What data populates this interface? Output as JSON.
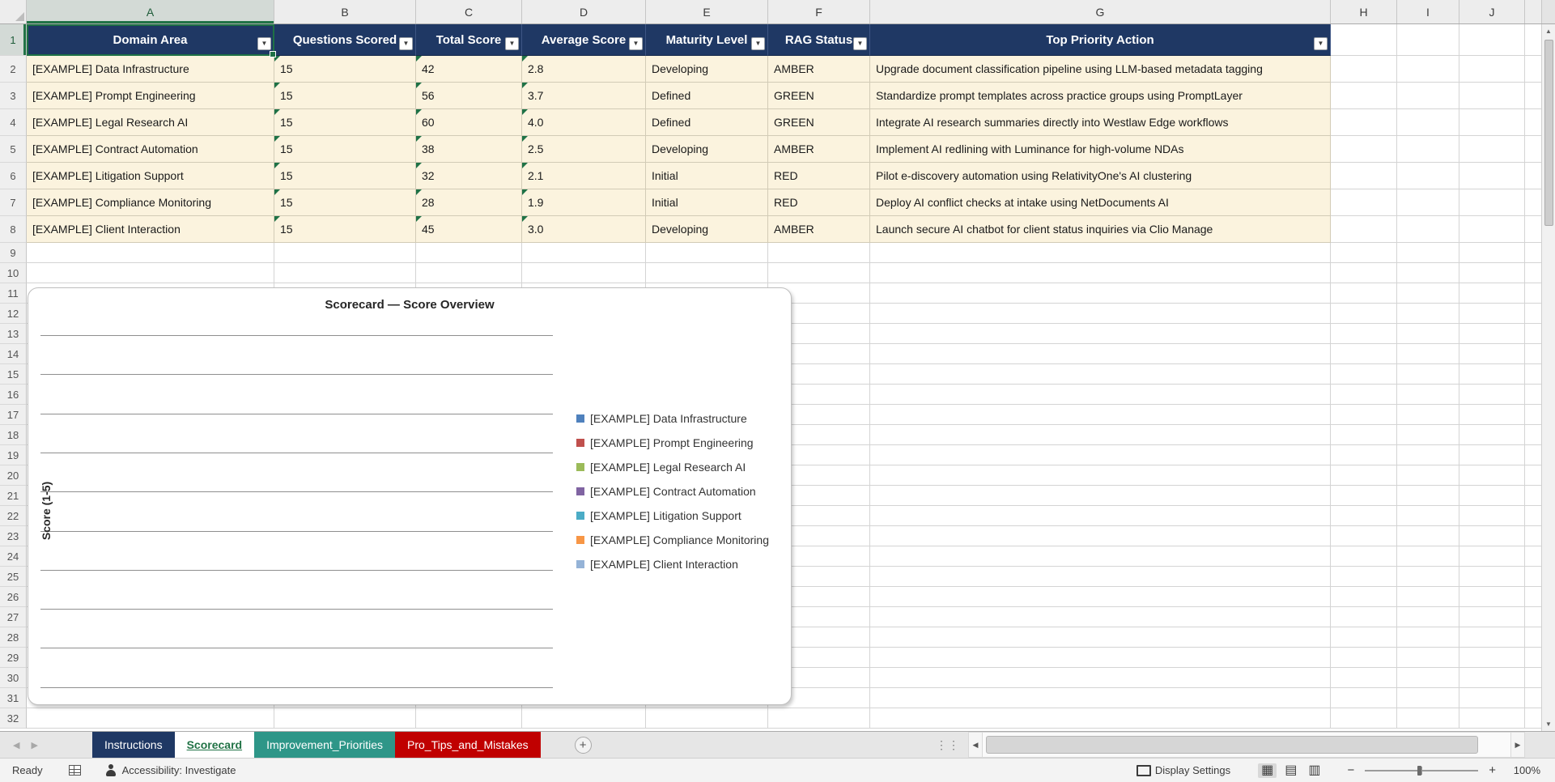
{
  "colors": {
    "accent_green": "#217346",
    "header_navy": "#1F3864",
    "row_fill": "#FBF3DE",
    "tab_instructions": "#1F3864",
    "tab_improvement": "#2E9688",
    "tab_pro_tips": "#C00000"
  },
  "sheet": {
    "columns": [
      {
        "letter": "A"
      },
      {
        "letter": "B"
      },
      {
        "letter": "C"
      },
      {
        "letter": "D"
      },
      {
        "letter": "E"
      },
      {
        "letter": "F"
      },
      {
        "letter": "G"
      },
      {
        "letter": "H"
      },
      {
        "letter": "I"
      },
      {
        "letter": "J"
      }
    ],
    "empty_row_numbers": [
      9,
      10,
      11,
      12,
      13,
      14,
      15,
      16,
      17,
      18,
      19,
      20,
      21,
      22,
      23,
      24,
      25,
      26,
      27,
      28,
      29,
      30,
      31,
      32
    ]
  },
  "table": {
    "header_row_number": "1",
    "headers": [
      {
        "label": "Domain Area"
      },
      {
        "label": "Questions Scored"
      },
      {
        "label": "Total Score"
      },
      {
        "label": "Average Score"
      },
      {
        "label": "Maturity Level"
      },
      {
        "label": "RAG Status"
      },
      {
        "label": "Top Priority Action"
      }
    ],
    "rows": [
      {
        "num": "2",
        "domain": "[EXAMPLE] Data Infrastructure",
        "questions": "15",
        "total": "42",
        "average": "2.8",
        "maturity": "Developing",
        "rag": "AMBER",
        "action": "Upgrade document classification pipeline using LLM-based metadata tagging"
      },
      {
        "num": "3",
        "domain": "[EXAMPLE] Prompt Engineering",
        "questions": "15",
        "total": "56",
        "average": "3.7",
        "maturity": "Defined",
        "rag": "GREEN",
        "action": "Standardize prompt templates across practice groups using PromptLayer"
      },
      {
        "num": "4",
        "domain": "[EXAMPLE] Legal Research AI",
        "questions": "15",
        "total": "60",
        "average": "4.0",
        "maturity": "Defined",
        "rag": "GREEN",
        "action": "Integrate AI research summaries directly into Westlaw Edge workflows"
      },
      {
        "num": "5",
        "domain": "[EXAMPLE] Contract Automation",
        "questions": "15",
        "total": "38",
        "average": "2.5",
        "maturity": "Developing",
        "rag": "AMBER",
        "action": "Implement AI redlining with Luminance for high-volume NDAs"
      },
      {
        "num": "6",
        "domain": "[EXAMPLE] Litigation Support",
        "questions": "15",
        "total": "32",
        "average": "2.1",
        "maturity": "Initial",
        "rag": "RED",
        "action": "Pilot e-discovery automation using RelativityOne's AI clustering"
      },
      {
        "num": "7",
        "domain": "[EXAMPLE] Compliance Monitoring",
        "questions": "15",
        "total": "28",
        "average": "1.9",
        "maturity": "Initial",
        "rag": "RED",
        "action": "Deploy AI conflict checks at intake using NetDocuments AI"
      },
      {
        "num": "8",
        "domain": "[EXAMPLE] Client Interaction",
        "questions": "15",
        "total": "45",
        "average": "3.0",
        "maturity": "Developing",
        "rag": "AMBER",
        "action": "Launch secure AI chatbot for client status inquiries via Clio Manage"
      }
    ]
  },
  "chart": {
    "title": "Scorecard — Score Overview",
    "y_axis_label": "Score (1-5)",
    "gridline_count": 10,
    "legend": [
      {
        "label": "[EXAMPLE] Data Infrastructure",
        "color": "#4F81BD"
      },
      {
        "label": "[EXAMPLE] Prompt Engineering",
        "color": "#C0504D"
      },
      {
        "label": "[EXAMPLE] Legal Research AI",
        "color": "#9BBB59"
      },
      {
        "label": "[EXAMPLE] Contract Automation",
        "color": "#8064A2"
      },
      {
        "label": "[EXAMPLE] Litigation Support",
        "color": "#4BACC6"
      },
      {
        "label": "[EXAMPLE] Compliance Monitoring",
        "color": "#F79646"
      },
      {
        "label": "[EXAMPLE] Client Interaction",
        "color": "#95B3D7"
      }
    ]
  },
  "tab_bar": {
    "new_sheet_icon": "+",
    "tabs": [
      {
        "label": "Instructions",
        "active": false
      },
      {
        "label": "Scorecard",
        "active": true
      },
      {
        "label": "Improvement_Priorities",
        "active": false
      },
      {
        "label": "Pro_Tips_and_Mistakes",
        "active": false
      }
    ]
  },
  "status_bar": {
    "mode": "Ready",
    "accessibility": "Accessibility: Investigate",
    "display_settings": "Display Settings",
    "zoom_level": "100%"
  }
}
